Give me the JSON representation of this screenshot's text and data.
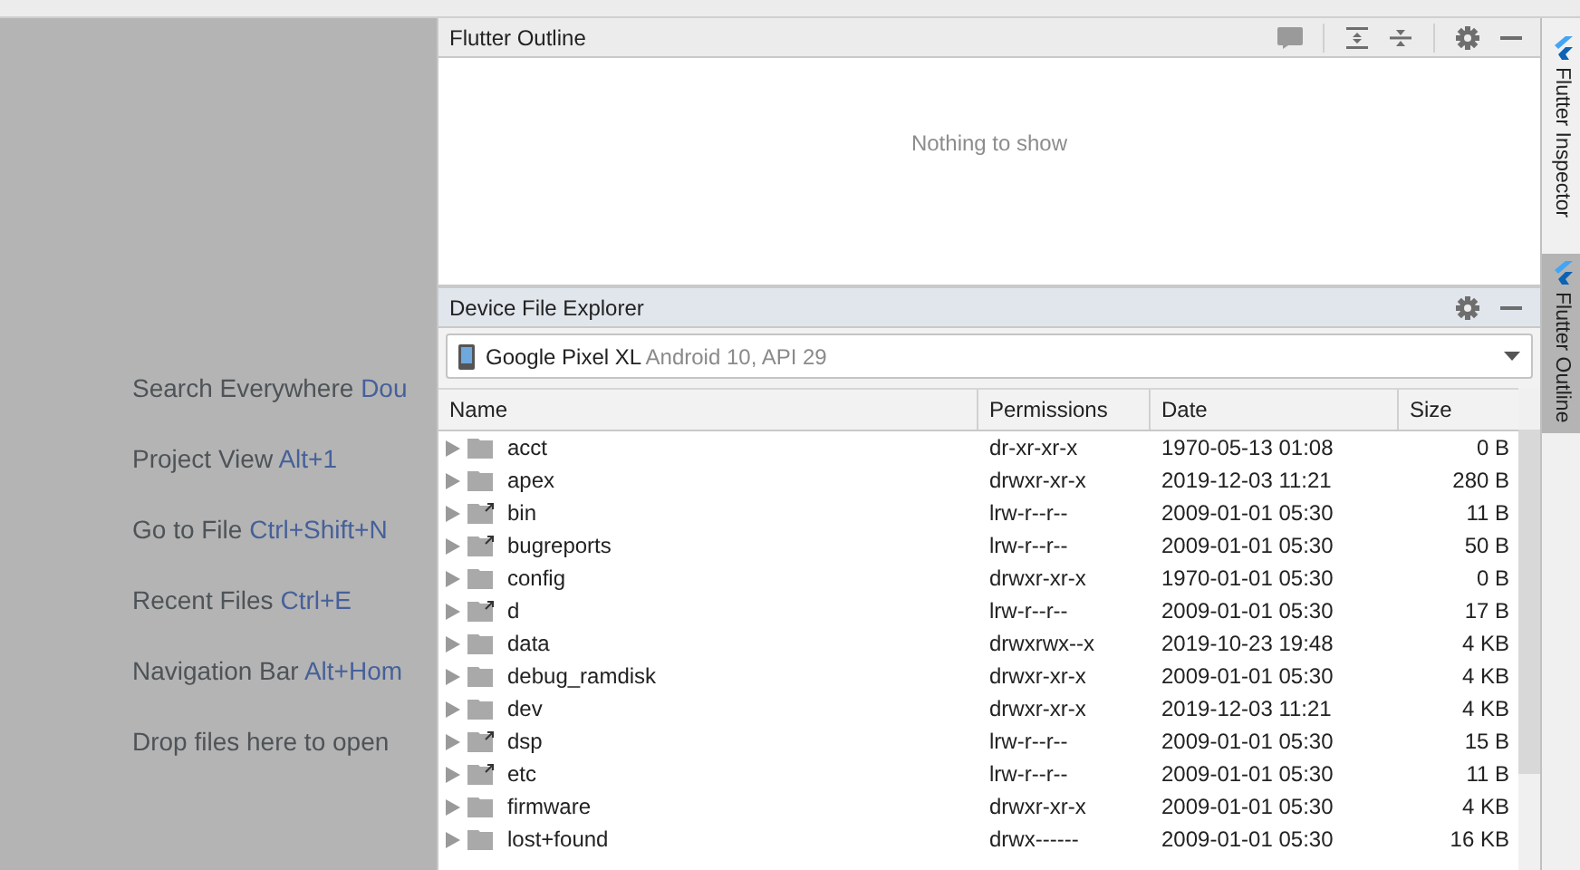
{
  "hints": [
    {
      "label": "Search Everywhere",
      "shortcut": "Dou"
    },
    {
      "label": "Project View",
      "shortcut": "Alt+1"
    },
    {
      "label": "Go to File",
      "shortcut": "Ctrl+Shift+N"
    },
    {
      "label": "Recent Files",
      "shortcut": "Ctrl+E"
    },
    {
      "label": "Navigation Bar",
      "shortcut": "Alt+Hom"
    },
    {
      "label": "Drop files here to open"
    }
  ],
  "outline": {
    "title": "Flutter Outline",
    "empty_text": "Nothing to show"
  },
  "explorer": {
    "title": "Device File Explorer",
    "device": {
      "name": "Google Pixel XL",
      "detail": "Android 10, API 29"
    },
    "columns": [
      "Name",
      "Permissions",
      "Date",
      "Size"
    ],
    "rows": [
      {
        "name": "acct",
        "permissions": "dr-xr-xr-x",
        "date": "1970-05-13 01:08",
        "size": "0 B",
        "symlink": false
      },
      {
        "name": "apex",
        "permissions": "drwxr-xr-x",
        "date": "2019-12-03 11:21",
        "size": "280 B",
        "symlink": false
      },
      {
        "name": "bin",
        "permissions": "lrw-r--r--",
        "date": "2009-01-01 05:30",
        "size": "11 B",
        "symlink": true
      },
      {
        "name": "bugreports",
        "permissions": "lrw-r--r--",
        "date": "2009-01-01 05:30",
        "size": "50 B",
        "symlink": true
      },
      {
        "name": "config",
        "permissions": "drwxr-xr-x",
        "date": "1970-01-01 05:30",
        "size": "0 B",
        "symlink": false
      },
      {
        "name": "d",
        "permissions": "lrw-r--r--",
        "date": "2009-01-01 05:30",
        "size": "17 B",
        "symlink": true
      },
      {
        "name": "data",
        "permissions": "drwxrwx--x",
        "date": "2019-10-23 19:48",
        "size": "4 KB",
        "symlink": false
      },
      {
        "name": "debug_ramdisk",
        "permissions": "drwxr-xr-x",
        "date": "2009-01-01 05:30",
        "size": "4 KB",
        "symlink": false
      },
      {
        "name": "dev",
        "permissions": "drwxr-xr-x",
        "date": "2019-12-03 11:21",
        "size": "4 KB",
        "symlink": false
      },
      {
        "name": "dsp",
        "permissions": "lrw-r--r--",
        "date": "2009-01-01 05:30",
        "size": "15 B",
        "symlink": true
      },
      {
        "name": "etc",
        "permissions": "lrw-r--r--",
        "date": "2009-01-01 05:30",
        "size": "11 B",
        "symlink": true
      },
      {
        "name": "firmware",
        "permissions": "drwxr-xr-x",
        "date": "2009-01-01 05:30",
        "size": "4 KB",
        "symlink": false
      },
      {
        "name": "lost+found",
        "permissions": "drwx------",
        "date": "2009-01-01 05:30",
        "size": "16 KB",
        "symlink": false
      }
    ]
  },
  "side_tabs": [
    {
      "label": "Flutter Inspector",
      "selected": false
    },
    {
      "label": "Flutter Outline",
      "selected": true
    }
  ]
}
